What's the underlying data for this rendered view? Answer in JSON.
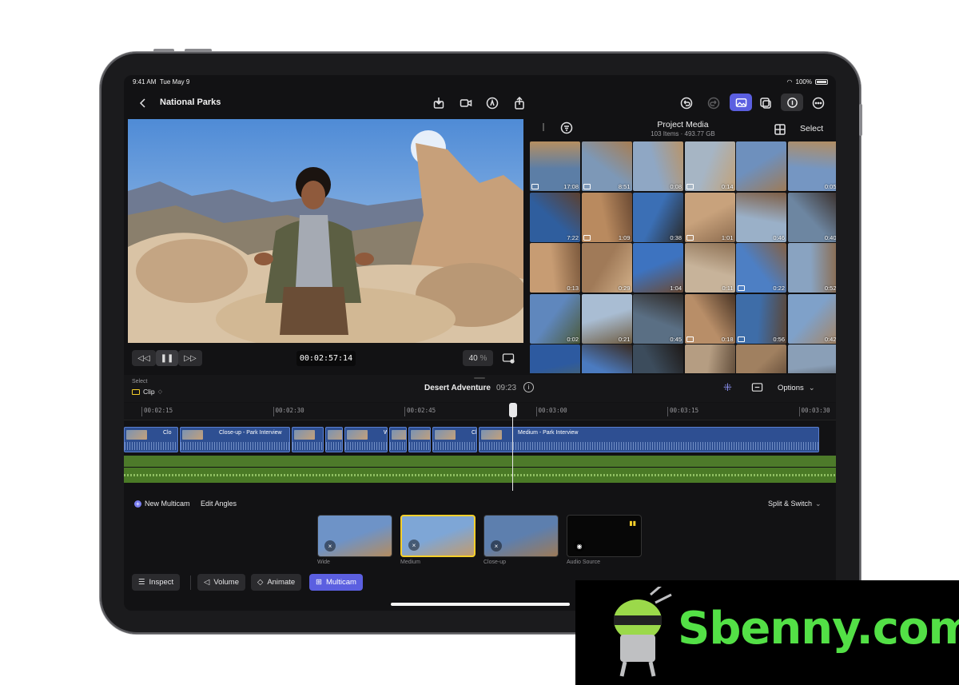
{
  "status_bar": {
    "time": "9:41 AM",
    "date": "Tue May 9",
    "battery": "100%"
  },
  "toolbar": {
    "project_title": "National Parks"
  },
  "viewer": {
    "timecode": "00:02:57:14",
    "zoom_value": "40",
    "zoom_unit": "%"
  },
  "browser": {
    "title": "Project Media",
    "item_count": "103 Items",
    "separator": "·",
    "size": "493.77 GB",
    "select_label": "Select",
    "thumbs": [
      {
        "dur": "17:08",
        "badge": true,
        "c1": "#5c7ea6",
        "c2": "#b58f61"
      },
      {
        "dur": "8:51",
        "badge": true,
        "c1": "#7d98b7",
        "c2": "#a77d52"
      },
      {
        "dur": "0:08",
        "badge": false,
        "c1": "#8fa7c4",
        "c2": "#b8946a"
      },
      {
        "dur": "0:14",
        "badge": true,
        "c1": "#a6b5c4",
        "c2": "#c1a27a"
      },
      {
        "dur": "",
        "badge": false,
        "c1": "#6e90bd",
        "c2": "#9d7b58"
      },
      {
        "dur": "0:05",
        "badge": false,
        "c1": "#7596c2",
        "c2": "#b28d62"
      },
      {
        "dur": "7:22",
        "badge": false,
        "c1": "#2f5e9e",
        "c2": "#5c4030"
      },
      {
        "dur": "1:09",
        "badge": true,
        "c1": "#b98a5f",
        "c2": "#6b4a33"
      },
      {
        "dur": "0:38",
        "badge": false,
        "c1": "#3b6fb5",
        "c2": "#2a2a2a"
      },
      {
        "dur": "1:01",
        "badge": true,
        "c1": "#c8a27c",
        "c2": "#8c6b4e"
      },
      {
        "dur": "0:46",
        "badge": false,
        "c1": "#9ab0c8",
        "c2": "#7e5e45"
      },
      {
        "dur": "0:40",
        "badge": false,
        "c1": "#6d86a1",
        "c2": "#3a2f2a"
      },
      {
        "dur": "0:13",
        "badge": false,
        "c1": "#c79c73",
        "c2": "#7d5a3d"
      },
      {
        "dur": "0:29",
        "badge": false,
        "c1": "#a07a58",
        "c2": "#d2b089"
      },
      {
        "dur": "1:04",
        "badge": false,
        "c1": "#3d73c0",
        "c2": "#6a4a35"
      },
      {
        "dur": "0:11",
        "badge": false,
        "c1": "#c7b39a",
        "c2": "#8e7154"
      },
      {
        "dur": "0:22",
        "badge": true,
        "c1": "#4d7fc4",
        "c2": "#846043"
      },
      {
        "dur": "0:52",
        "badge": false,
        "c1": "#89a3c1",
        "c2": "#8a6a4c"
      },
      {
        "dur": "0:02",
        "badge": false,
        "c1": "#5f87bd",
        "c2": "#4c5a3a"
      },
      {
        "dur": "0:21",
        "badge": false,
        "c1": "#a9bdd3",
        "c2": "#6f5d43"
      },
      {
        "dur": "0:45",
        "badge": false,
        "c1": "#5a6f84",
        "c2": "#2f2a27"
      },
      {
        "dur": "0:18",
        "badge": true,
        "c1": "#b88e68",
        "c2": "#4a3525"
      },
      {
        "dur": "0:56",
        "badge": true,
        "c1": "#3e6da8",
        "c2": "#5b4636"
      },
      {
        "dur": "0:42",
        "badge": false,
        "c1": "#7fa1c9",
        "c2": "#a68462"
      },
      {
        "dur": "",
        "badge": false,
        "c1": "#2d5aa0",
        "c2": "#5a6a4a"
      },
      {
        "dur": "",
        "badge": false,
        "c1": "#4b7bc0",
        "c2": "#3a2c22"
      },
      {
        "dur": "",
        "badge": false,
        "c1": "#3c4c5c",
        "c2": "#1e1a18"
      },
      {
        "dur": "",
        "badge": false,
        "c1": "#b59d82",
        "c2": "#5a4634"
      },
      {
        "dur": "",
        "badge": false,
        "c1": "#a08060",
        "c2": "#4e3a2a"
      },
      {
        "dur": "",
        "badge": false,
        "c1": "#8a9fb7",
        "c2": "#2b2420"
      }
    ]
  },
  "timeline": {
    "select_label": "Select",
    "select_value": "Clip",
    "project_name": "Desert Adventure",
    "duration": "09:23",
    "options_label": "Options",
    "ruler": [
      "00:02:15",
      "00:02:30",
      "00:02:45",
      "00:03:00",
      "00:03:15",
      "00:03:30"
    ],
    "clips": [
      {
        "label": "Clo",
        "w": 70
      },
      {
        "label": "Close-up - Park Interview",
        "w": 140
      },
      {
        "label": "",
        "w": 42
      },
      {
        "label": "",
        "w": 24
      },
      {
        "label": "W",
        "w": 56
      },
      {
        "label": "",
        "w": 24
      },
      {
        "label": "",
        "w": 30
      },
      {
        "label": "Cl",
        "w": 58
      },
      {
        "label": "Medium - Park Interview",
        "w": 428
      }
    ]
  },
  "multicam": {
    "new_label": "New Multicam",
    "edit_label": "Edit Angles",
    "mode_label": "Split & Switch",
    "angles": [
      {
        "label": "Wide",
        "c1": "#6e93c7",
        "c2": "#b48c5f",
        "active": false
      },
      {
        "label": "Medium",
        "c1": "#7ea6d6",
        "c2": "#c29b6d",
        "active": true
      },
      {
        "label": "Close-up",
        "c1": "#5d7fae",
        "c2": "#9c7a58",
        "active": false
      },
      {
        "label": "Audio Source",
        "c1": "#070707",
        "c2": "#070707",
        "active": false
      }
    ]
  },
  "bottom_bar": {
    "inspect": "Inspect",
    "volume": "Volume",
    "animate": "Animate",
    "multicam": "Multicam"
  },
  "colors": {
    "accent": "#5b5fe0",
    "selection": "#f5cf2b",
    "clip_blue": "#2e4f92",
    "audio_green": "#4d7a2a"
  },
  "watermark": {
    "text": "Sbenny.com"
  }
}
